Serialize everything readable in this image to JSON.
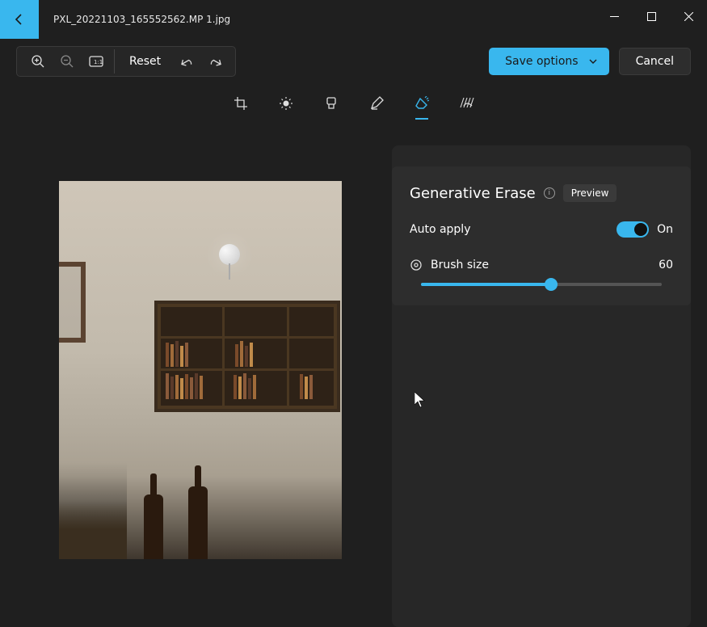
{
  "window": {
    "filename": "PXL_20221103_165552562.MP 1.jpg"
  },
  "toolbar": {
    "reset_label": "Reset",
    "save_label": "Save options",
    "cancel_label": "Cancel"
  },
  "panel": {
    "title": "Generative Erase",
    "preview_badge": "Preview",
    "auto_apply_label": "Auto apply",
    "auto_apply_state": "On",
    "brush_label": "Brush size",
    "brush_value": "60",
    "brush_percent": 54
  }
}
